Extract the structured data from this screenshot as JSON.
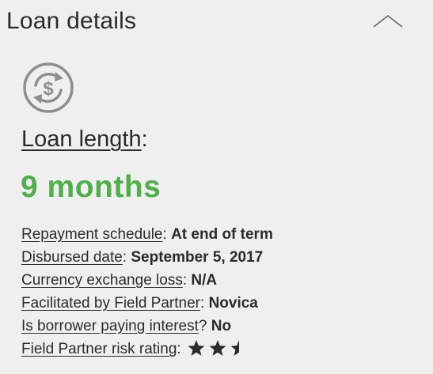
{
  "header": {
    "title": "Loan details",
    "collapse_icon": "chevron-up-icon"
  },
  "loan_length": {
    "icon": "currency-exchange-icon",
    "label": "Loan length",
    "separator": ":",
    "value": "9 months"
  },
  "details": [
    {
      "term": "Repayment schedule",
      "sep": ": ",
      "value": "At end of term"
    },
    {
      "term": "Disbursed date",
      "sep": ": ",
      "value": "September 5, 2017"
    },
    {
      "term": "Currency exchange loss",
      "sep": ": ",
      "value": "N/A"
    },
    {
      "term": "Facilitated by Field Partner",
      "sep": ": ",
      "value": "Novica"
    },
    {
      "term": "Is borrower paying interest",
      "sep": "? ",
      "value": "No"
    },
    {
      "term": "Field Partner risk rating",
      "sep": ":",
      "rating": 2.5,
      "rating_max": 5
    }
  ],
  "colors": {
    "accent_green": "#4faf4b",
    "text": "#2b2b2b",
    "background": "#efefef",
    "icon_gray": "#8e8e8e"
  }
}
